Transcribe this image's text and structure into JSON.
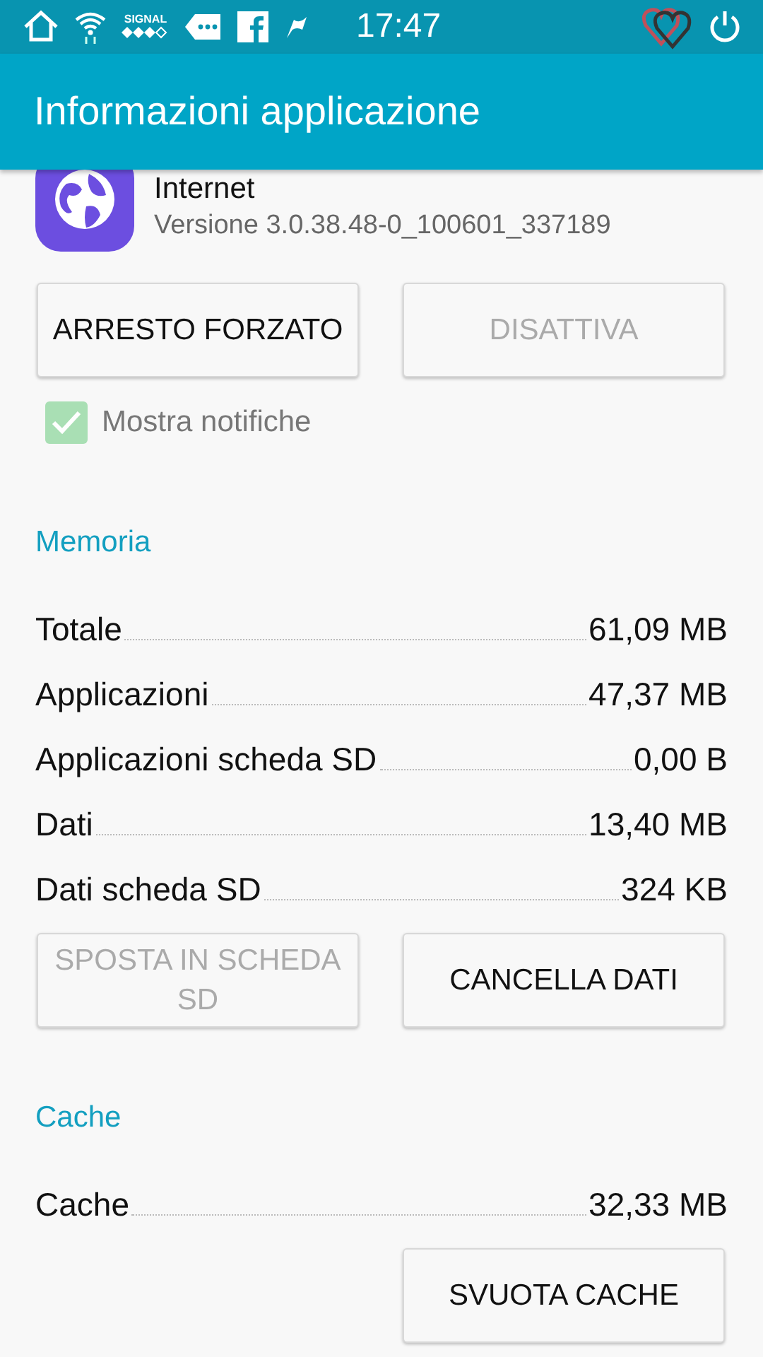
{
  "status_bar": {
    "signal_label": "SIGNAL",
    "time": "17:47"
  },
  "toolbar": {
    "title": "Informazioni applicazione"
  },
  "app": {
    "name": "Internet",
    "version": "Versione 3.0.38.48-0_100601_337189"
  },
  "app_buttons": [
    {
      "label": "ARRESTO FORZATO",
      "disabled": false
    },
    {
      "label": "DISATTIVA",
      "disabled": true
    }
  ],
  "notifications": {
    "label": "Mostra notifiche",
    "checked": true,
    "disabled": true
  },
  "sections": [
    {
      "title": "Memoria",
      "rows": [
        {
          "label": "Totale",
          "value": "61,09 MB"
        },
        {
          "label": "Applicazioni",
          "value": "47,37 MB"
        },
        {
          "label": "Applicazioni scheda SD",
          "value": "0,00 B"
        },
        {
          "label": "Dati",
          "value": "13,40 MB"
        },
        {
          "label": "Dati scheda SD",
          "value": "324 KB"
        }
      ],
      "buttons": [
        {
          "label": "SPOSTA IN SCHEDA SD",
          "disabled": true
        },
        {
          "label": "CANCELLA DATI",
          "disabled": false
        }
      ]
    },
    {
      "title": "Cache",
      "rows": [
        {
          "label": "Cache",
          "value": "32,33 MB"
        }
      ],
      "buttons": [
        {
          "label": "SVUOTA CACHE",
          "disabled": false
        }
      ]
    }
  ]
}
